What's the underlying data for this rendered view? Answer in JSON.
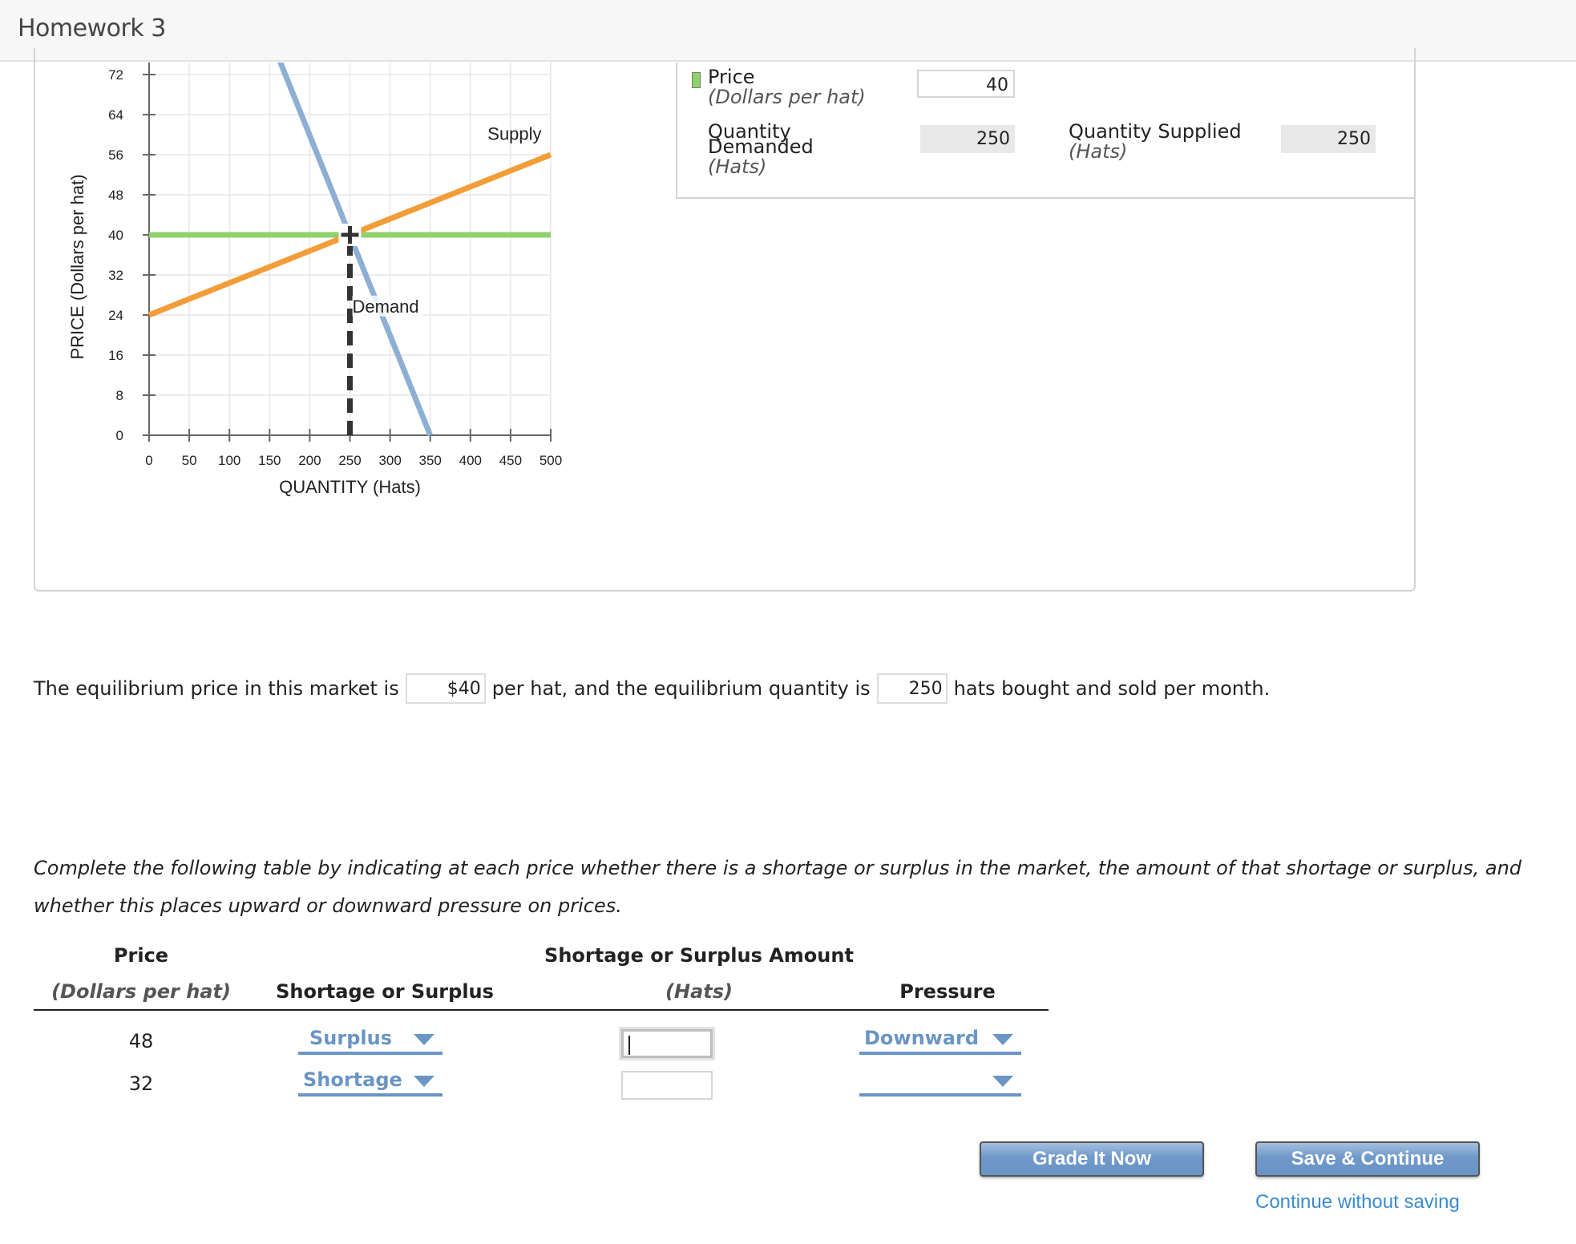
{
  "header": {
    "title": "Homework 3"
  },
  "chart_data": {
    "type": "line",
    "xlabel": "QUANTITY (Hats)",
    "ylabel": "PRICE (Dollars per hat)",
    "xlim": [
      0,
      500
    ],
    "ylim": [
      0,
      72
    ],
    "x_ticks": [
      0,
      50,
      100,
      150,
      200,
      250,
      300,
      350,
      400,
      450,
      500
    ],
    "y_ticks": [
      0,
      8,
      16,
      24,
      32,
      40,
      48,
      56,
      64,
      72
    ],
    "grid": true,
    "series": [
      {
        "name": "Supply",
        "color": "#f29d38",
        "points": [
          [
            0,
            24
          ],
          [
            500,
            56
          ]
        ]
      },
      {
        "name": "Demand",
        "color": "#8eafd4",
        "points": [
          [
            162,
            75
          ],
          [
            350,
            0
          ]
        ]
      },
      {
        "name": "Price line",
        "color": "#8fd16b",
        "points": [
          [
            0,
            40
          ],
          [
            500,
            40
          ]
        ]
      }
    ],
    "marker": {
      "x": 250,
      "y": 40,
      "label": "equilibrium cursor"
    },
    "dashed_line": {
      "x": 250,
      "from_y": 0,
      "to_y": 40
    },
    "annotations": [
      {
        "text": "Supply",
        "x": 455,
        "y": 59
      },
      {
        "text": "Demand",
        "x": 250,
        "y": 25
      }
    ]
  },
  "info_panel": {
    "price_label": "Price",
    "price_unit": "(Dollars per hat)",
    "price_value": "40",
    "qd_label_line1": "Quantity",
    "qd_label_line2": "Demanded",
    "qd_unit": "(Hats)",
    "qd_value": "250",
    "qs_label": "Quantity Supplied",
    "qs_unit": "(Hats)",
    "qs_value": "250"
  },
  "sentence": {
    "part1": "The equilibrium price in this market is",
    "price_value": "$40",
    "part2": "per hat, and the equilibrium quantity is",
    "quantity_value": "250",
    "part3": "hats bought and sold per month."
  },
  "instructions": "Complete the following table by indicating at each price whether there is a shortage or surplus in the market, the amount of that shortage or surplus, and whether this places upward or downward pressure on prices.",
  "table": {
    "headers": {
      "price": "Price",
      "price_unit": "(Dollars per hat)",
      "shortage_surplus": "Shortage or Surplus",
      "amount": "Shortage or Surplus Amount",
      "amount_unit": "(Hats)",
      "pressure": "Pressure"
    },
    "rows": [
      {
        "price": "48",
        "shortage_surplus": "Surplus",
        "amount": "",
        "pressure": "Downward"
      },
      {
        "price": "32",
        "shortage_surplus": "Shortage",
        "amount": "",
        "pressure": ""
      }
    ]
  },
  "buttons": {
    "grade": "Grade It Now",
    "save": "Save & Continue",
    "continue_link": "Continue without saving"
  }
}
